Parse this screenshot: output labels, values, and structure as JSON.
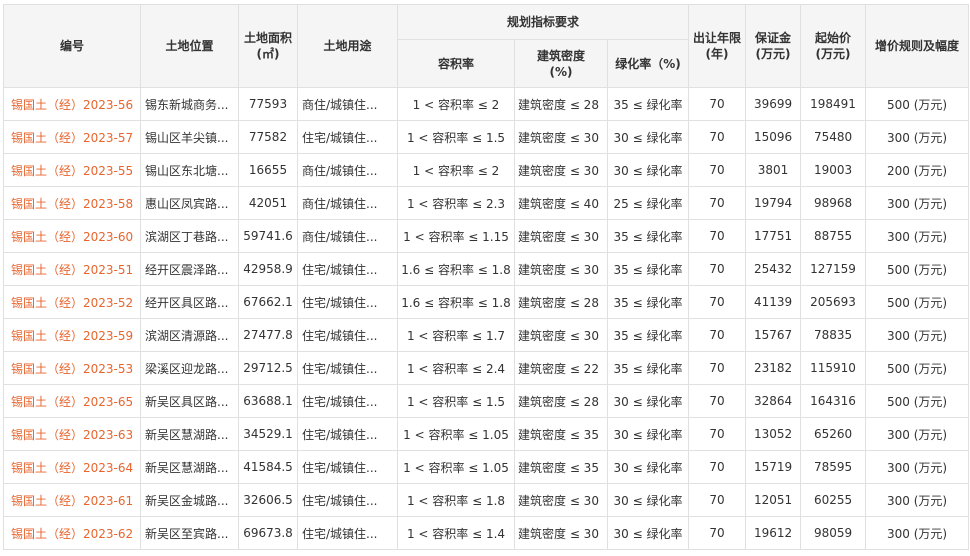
{
  "header": {
    "code": "编号",
    "location": "土地位置",
    "area": "土地面积(㎡)",
    "use": "土地用途",
    "planning": "规划指标要求",
    "plot_ratio": "容积率",
    "density": "建筑密度(%)",
    "greening": "绿化率（%)",
    "term": "出让年限(年)",
    "deposit": "保证金(万元)",
    "start_price": "起始价(万元)",
    "increment": "增价规则及幅度"
  },
  "rows": [
    {
      "code": "锡国土（经）2023-56",
      "location": "锡东新城商务...",
      "area": "77593",
      "use": "商住/城镇住...",
      "ratio": "1 < 容积率 ≤ 2",
      "density": "建筑密度 ≤ 28",
      "greening": "35 ≤ 绿化率",
      "term": "70",
      "deposit": "39699",
      "price": "198491",
      "increment": "500 (万元)"
    },
    {
      "code": "锡国土（经）2023-57",
      "location": "锡山区羊尖镇...",
      "area": "77582",
      "use": "住宅/城镇住...",
      "ratio": "1 < 容积率 ≤ 1.5",
      "density": "建筑密度 ≤ 30",
      "greening": "30 ≤ 绿化率",
      "term": "70",
      "deposit": "15096",
      "price": "75480",
      "increment": "300 (万元)"
    },
    {
      "code": "锡国土（经）2023-55",
      "location": "锡山区东北塘...",
      "area": "16655",
      "use": "商住/城镇住...",
      "ratio": "1 < 容积率 ≤ 2",
      "density": "建筑密度 ≤ 30",
      "greening": "30 ≤ 绿化率",
      "term": "70",
      "deposit": "3801",
      "price": "19003",
      "increment": "200 (万元)"
    },
    {
      "code": "锡国土（经）2023-58",
      "location": "惠山区凤宾路...",
      "area": "42051",
      "use": "商住/城镇住...",
      "ratio": "1 < 容积率 ≤ 2.3",
      "density": "建筑密度 ≤ 40",
      "greening": "25 ≤ 绿化率",
      "term": "70",
      "deposit": "19794",
      "price": "98968",
      "increment": "300 (万元)"
    },
    {
      "code": "锡国土（经）2023-60",
      "location": "滨湖区丁巷路...",
      "area": "59741.6",
      "use": "商住/城镇住...",
      "ratio": "1 < 容积率 ≤ 1.15",
      "density": "建筑密度 ≤ 30",
      "greening": "35 ≤ 绿化率",
      "term": "70",
      "deposit": "17751",
      "price": "88755",
      "increment": "300 (万元)"
    },
    {
      "code": "锡国土（经）2023-51",
      "location": "经开区震泽路...",
      "area": "42958.9",
      "use": "住宅/城镇住...",
      "ratio": "1.6 ≤ 容积率 ≤ 1.8",
      "density": "建筑密度 ≤ 30",
      "greening": "35 ≤ 绿化率",
      "term": "70",
      "deposit": "25432",
      "price": "127159",
      "increment": "500 (万元)"
    },
    {
      "code": "锡国土（经）2023-52",
      "location": "经开区具区路...",
      "area": "67662.1",
      "use": "住宅/城镇住...",
      "ratio": "1.6 ≤ 容积率 ≤ 1.8",
      "density": "建筑密度 ≤ 28",
      "greening": "35 ≤ 绿化率",
      "term": "70",
      "deposit": "41139",
      "price": "205693",
      "increment": "500 (万元)"
    },
    {
      "code": "锡国土（经）2023-59",
      "location": "滨湖区清源路...",
      "area": "27477.8",
      "use": "住宅/城镇住...",
      "ratio": "1 < 容积率 ≤ 1.7",
      "density": "建筑密度 ≤ 30",
      "greening": "35 ≤ 绿化率",
      "term": "70",
      "deposit": "15767",
      "price": "78835",
      "increment": "300 (万元)"
    },
    {
      "code": "锡国土（经）2023-53",
      "location": "梁溪区迎龙路...",
      "area": "29712.5",
      "use": "住宅/城镇住...",
      "ratio": "1 < 容积率 ≤ 2.4",
      "density": "建筑密度 ≤ 22",
      "greening": "35 ≤ 绿化率",
      "term": "70",
      "deposit": "23182",
      "price": "115910",
      "increment": "500 (万元)"
    },
    {
      "code": "锡国土（经）2023-65",
      "location": "新吴区具区路...",
      "area": "63688.1",
      "use": "住宅/城镇住...",
      "ratio": "1 < 容积率 ≤ 1.5",
      "density": "建筑密度 ≤ 28",
      "greening": "30 ≤ 绿化率",
      "term": "70",
      "deposit": "32864",
      "price": "164316",
      "increment": "500 (万元)"
    },
    {
      "code": "锡国土（经）2023-63",
      "location": "新吴区慧湖路...",
      "area": "34529.1",
      "use": "住宅/城镇住...",
      "ratio": "1 < 容积率 ≤ 1.05",
      "density": "建筑密度 ≤ 35",
      "greening": "30 ≤ 绿化率",
      "term": "70",
      "deposit": "13052",
      "price": "65260",
      "increment": "300 (万元)"
    },
    {
      "code": "锡国土（经）2023-64",
      "location": "新吴区慧湖路...",
      "area": "41584.5",
      "use": "住宅/城镇住...",
      "ratio": "1 < 容积率 ≤ 1.05",
      "density": "建筑密度 ≤ 35",
      "greening": "30 ≤ 绿化率",
      "term": "70",
      "deposit": "15719",
      "price": "78595",
      "increment": "300 (万元)"
    },
    {
      "code": "锡国土（经）2023-61",
      "location": "新吴区金城路...",
      "area": "32606.5",
      "use": "住宅/城镇住...",
      "ratio": "1 < 容积率 ≤ 1.8",
      "density": "建筑密度 ≤ 30",
      "greening": "30 ≤ 绿化率",
      "term": "70",
      "deposit": "12051",
      "price": "60255",
      "increment": "300 (万元)"
    },
    {
      "code": "锡国土（经）2023-62",
      "location": "新吴区至宾路...",
      "area": "69673.8",
      "use": "住宅/城镇住...",
      "ratio": "1 < 容积率 ≤ 1.4",
      "density": "建筑密度 ≤ 30",
      "greening": "30 ≤ 绿化率",
      "term": "70",
      "deposit": "19612",
      "price": "98059",
      "increment": "300 (万元)"
    }
  ]
}
